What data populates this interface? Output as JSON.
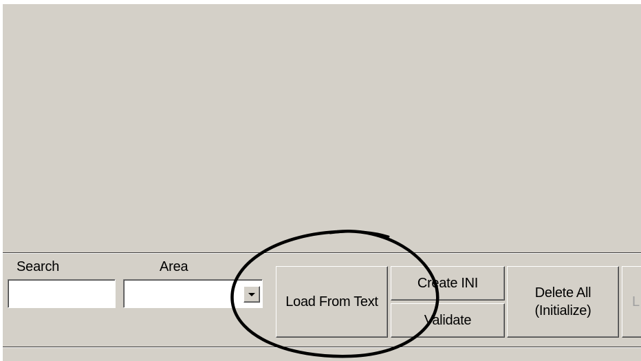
{
  "search": {
    "label": "Search",
    "value": ""
  },
  "area": {
    "label": "Area",
    "value": "",
    "dropdown_icon": "chevron-down-icon"
  },
  "buttons": {
    "load_from_text": "Load From Text",
    "create_ini": "Create INI",
    "validate": "Validate",
    "delete_all_line1": "Delete All",
    "delete_all_line2": "(Initialize)",
    "partial": "L"
  },
  "annotation": {
    "shape": "hand-drawn ellipse",
    "color": "#000000"
  },
  "colors": {
    "panel": "#d4d0c8",
    "highlight": "#ffffff",
    "shadow": "#808080",
    "dark_shadow": "#404040"
  }
}
